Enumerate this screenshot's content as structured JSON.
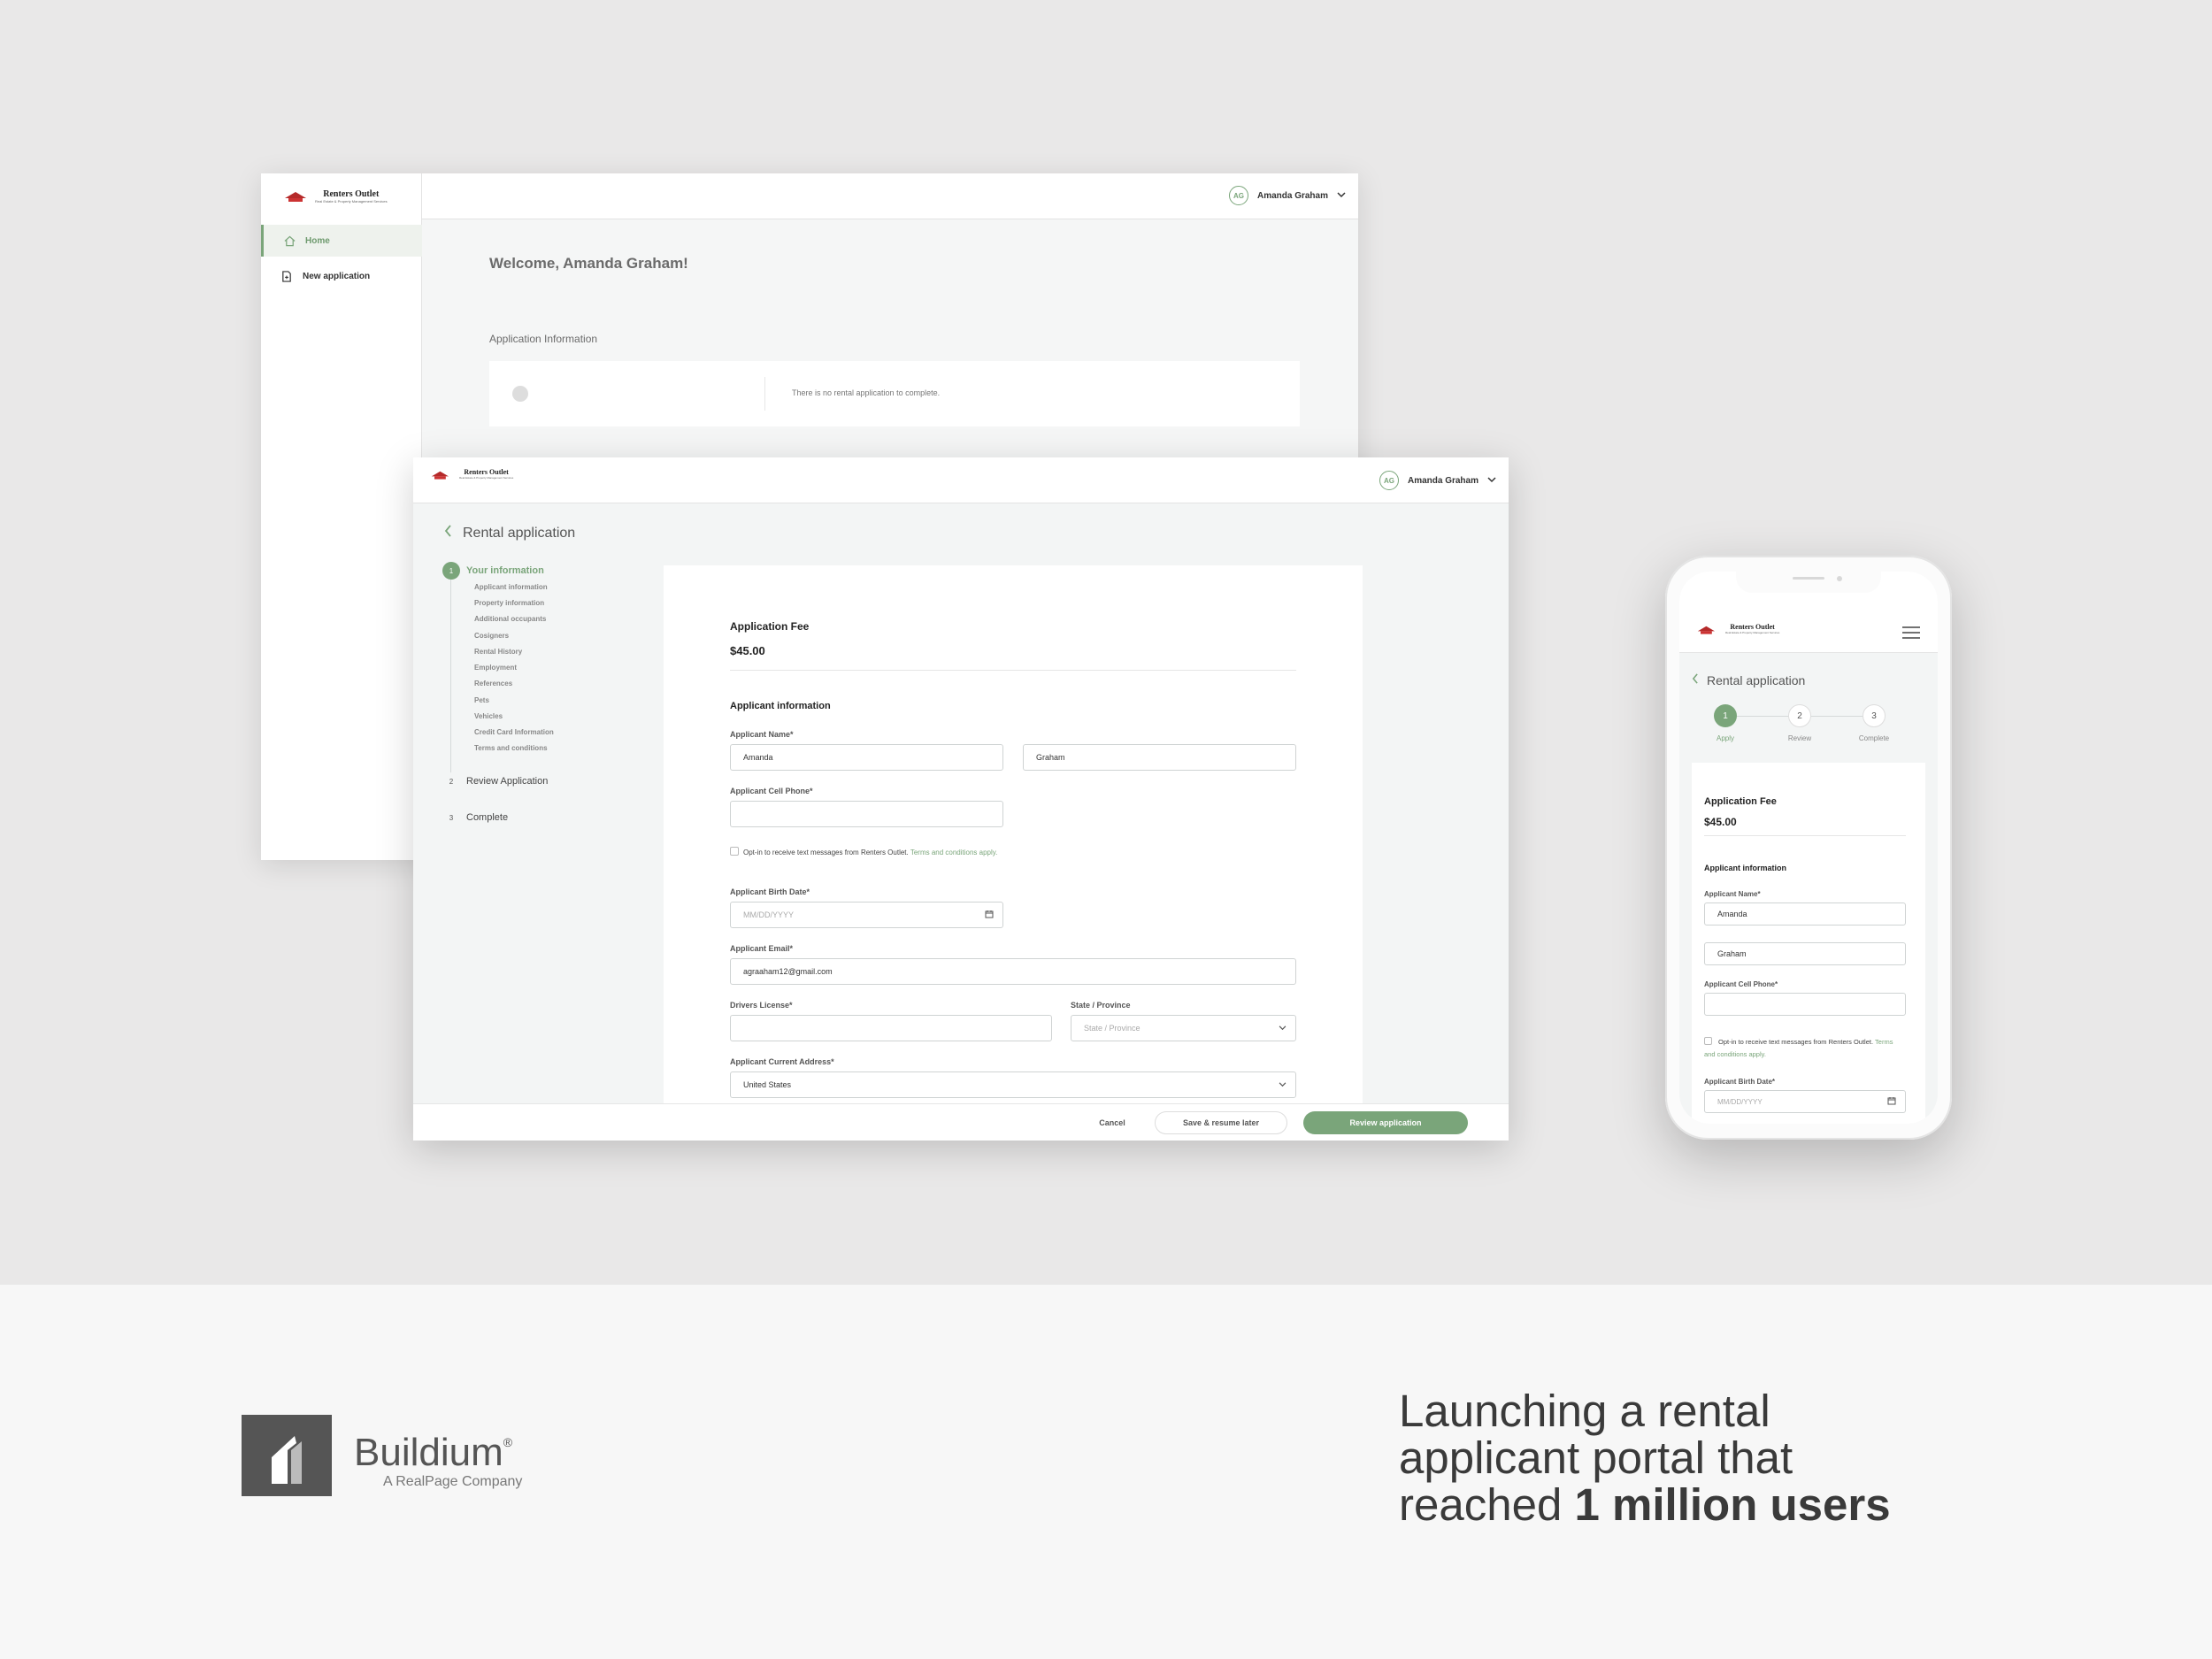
{
  "brand": {
    "name": "Renters Outlet",
    "tag": "Real Estate & Property Management Services"
  },
  "user": {
    "initials": "AG",
    "name": "Amanda Graham"
  },
  "dashboard": {
    "nav": [
      {
        "label": "Home",
        "icon": "home-icon"
      },
      {
        "label": "New application",
        "icon": "document-icon"
      }
    ],
    "welcome": "Welcome, Amanda Graham!",
    "section": "Application Information",
    "empty": "There is no rental application to complete."
  },
  "application": {
    "title": "Rental application",
    "steps": [
      {
        "num": "1",
        "label": "Your information"
      },
      {
        "num": "2",
        "label": "Review Application"
      },
      {
        "num": "3",
        "label": "Complete"
      }
    ],
    "substeps": [
      "Applicant information",
      "Property information",
      "Additional occupants",
      "Cosigners",
      "Rental History",
      "Employment",
      "References",
      "Pets",
      "Vehicles",
      "Credit Card Information",
      "Terms and conditions"
    ],
    "fee_label": "Application Fee",
    "fee_value": "$45.00",
    "section": "Applicant information",
    "name_label": "Applicant Name*",
    "first_name": "Amanda",
    "last_name": "Graham",
    "phone_label": "Applicant Cell Phone*",
    "optin_text": "Opt-in to receive text messages from Renters Outlet.",
    "optin_link": "Terms and conditions apply.",
    "birth_label": "Applicant Birth Date*",
    "birth_placeholder": "MM/DD/YYYY",
    "email_label": "Applicant Email*",
    "email_value": "agraaham12@gmail.com",
    "license_label": "Drivers License*",
    "state_label": "State / Province",
    "state_placeholder": "State / Province",
    "address_label": "Applicant Current Address*",
    "address_value": "United States",
    "cancel": "Cancel",
    "save": "Save & resume later",
    "review": "Review application"
  },
  "mobile": {
    "title": "Rental application",
    "steps": [
      {
        "num": "1",
        "label": "Apply"
      },
      {
        "num": "2",
        "label": "Review"
      },
      {
        "num": "3",
        "label": "Complete"
      }
    ],
    "optin_text": "Opt-in to receive text messages from Renters Outlet.",
    "optin_link": "Terms and conditions apply."
  },
  "footer": {
    "company": "Buildium",
    "registered": "®",
    "subtitle": "A RealPage Company",
    "headline_1": "Launching a rental",
    "headline_2": "applicant portal that",
    "headline_3": "reached ",
    "headline_bold": "1 million users"
  },
  "colors": {
    "accent": "#7aa57a",
    "background": "#e9e8e8",
    "logo_red": "#b52a2a"
  }
}
